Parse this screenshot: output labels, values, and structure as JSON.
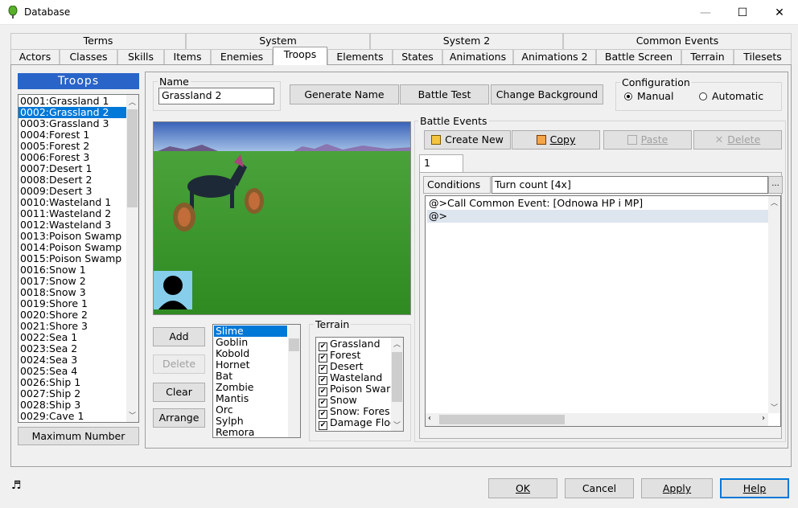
{
  "window": {
    "title": "Database",
    "minimize": "—",
    "maximize": "☐",
    "close": "✕"
  },
  "tabs_top": [
    "Terms",
    "System",
    "System 2",
    "Common Events"
  ],
  "tabs_bottom": [
    "Actors",
    "Classes",
    "Skills",
    "Items",
    "Enemies",
    "Troops",
    "Elements",
    "States",
    "Animations",
    "Animations 2",
    "Battle Screen",
    "Terrain",
    "Tilesets"
  ],
  "selected_tab": "Troops",
  "troops": {
    "title": "Troops",
    "items": [
      "0001:Grassland 1",
      "0002:Grassland 2",
      "0003:Grassland 3",
      "0004:Forest 1",
      "0005:Forest 2",
      "0006:Forest 3",
      "0007:Desert 1",
      "0008:Desert 2",
      "0009:Desert 3",
      "0010:Wasteland 1",
      "0011:Wasteland 2",
      "0012:Wasteland 3",
      "0013:Poison Swamp",
      "0014:Poison Swamp",
      "0015:Poison Swamp",
      "0016:Snow 1",
      "0017:Snow 2",
      "0018:Snow 3",
      "0019:Shore 1",
      "0020:Shore 2",
      "0021:Shore 3",
      "0022:Sea 1",
      "0023:Sea 2",
      "0024:Sea 3",
      "0025:Sea 4",
      "0026:Ship 1",
      "0027:Ship 2",
      "0028:Ship 3",
      "0029:Cave 1"
    ],
    "selected_index": 1,
    "max_button": "Maximum Number"
  },
  "name": {
    "label": "Name",
    "value": "Grassland 2"
  },
  "buttons": {
    "generate": "Generate Name",
    "battle_test": "Battle Test",
    "change_bg": "Change Background",
    "add": "Add",
    "delete": "Delete",
    "clear": "Clear",
    "arrange": "Arrange"
  },
  "configuration": {
    "label": "Configuration",
    "manual": "Manual",
    "automatic": "Automatic",
    "selected": "Manual"
  },
  "enemies": {
    "items": [
      "Slime",
      "Goblin",
      "Kobold",
      "Hornet",
      "Bat",
      "Zombie",
      "Mantis",
      "Orc",
      "Sylph",
      "Remora"
    ],
    "selected_index": 0
  },
  "terrain": {
    "label": "Terrain",
    "items": [
      "Grassland",
      "Forest",
      "Desert",
      "Wasteland",
      "Poison Swar",
      "Snow",
      "Snow: Fores",
      "Damage Floo"
    ],
    "checked": true
  },
  "battle_events": {
    "label": "Battle Events",
    "create_new": "Create New",
    "copy": "Copy",
    "paste": "Paste",
    "delete": "Delete",
    "page_tab": "1",
    "conditions_label": "Conditions",
    "conditions_value": "Turn count [4x]",
    "ellipsis": "...",
    "lines": [
      "@>Call Common Event: [Odnowa HP i MP]",
      "@>"
    ]
  },
  "footer": {
    "ok": "OK",
    "cancel": "Cancel",
    "apply": "Apply",
    "help": "Help",
    "music_icon": "music-note-icon"
  },
  "colors": {
    "accent": "#0078d7",
    "panel_title": "#2964c8"
  }
}
